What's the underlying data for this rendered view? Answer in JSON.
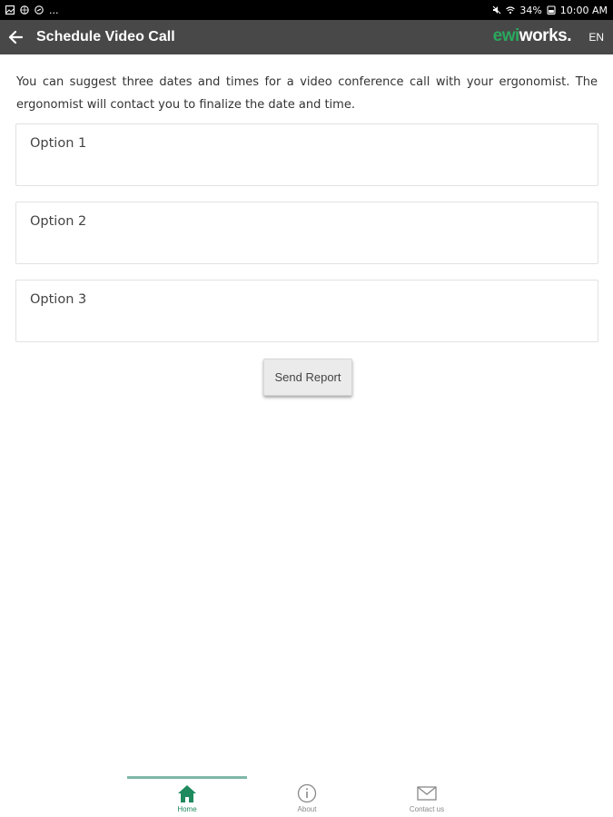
{
  "status_bar": {
    "dots": "...",
    "battery": "34%",
    "time": "10:00 AM"
  },
  "app_bar": {
    "title": "Schedule Video Call",
    "brand_part1": "ewi",
    "brand_part2": "works.",
    "language": "EN"
  },
  "content": {
    "intro": "You can suggest three dates and times for a video conference call with your ergonomist. The ergonomist will contact you to finalize the date and time.",
    "options": [
      {
        "label": "Option 1"
      },
      {
        "label": "Option 2"
      },
      {
        "label": "Option 3"
      }
    ],
    "send_button": "Send Report"
  },
  "bottom_nav": {
    "items": [
      {
        "label": "Home",
        "icon": "home-icon",
        "active": true
      },
      {
        "label": "About",
        "icon": "info-icon",
        "active": false
      },
      {
        "label": "Contact us",
        "icon": "mail-icon",
        "active": false
      }
    ]
  },
  "colors": {
    "app_bar": "#484848",
    "brand_green": "#2aa85e",
    "active_nav": "#1e8a5e"
  }
}
